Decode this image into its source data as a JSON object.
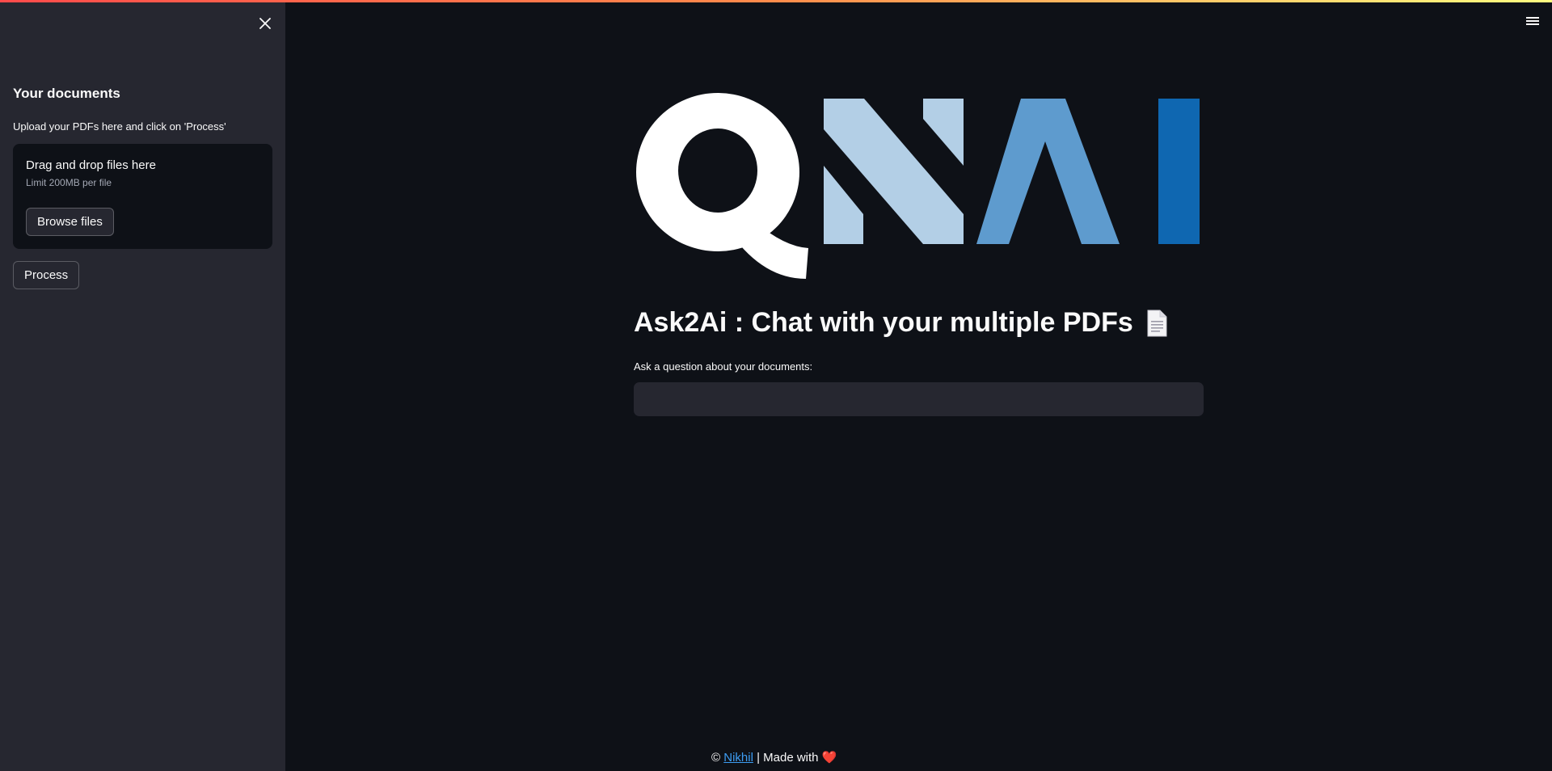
{
  "sidebar": {
    "close_icon": "close-icon",
    "heading": "Your documents",
    "upload_label": "Upload your PDFs here and click on 'Process'",
    "dropzone": {
      "title": "Drag and drop files here",
      "limit": "Limit 200MB per file",
      "browse_label": "Browse files"
    },
    "process_label": "Process"
  },
  "header": {
    "menu_icon": "hamburger-menu-icon"
  },
  "main": {
    "logo_text": "QNAI",
    "title": "Ask2Ai : Chat with your multiple PDFs",
    "title_icon": "document-icon",
    "question_label": "Ask a question about your documents:",
    "question_value": ""
  },
  "footer": {
    "copyright": "©",
    "author": "Nikhil",
    "made_with": "| Made with",
    "heart": "❤️"
  },
  "colors": {
    "background": "#0e1117",
    "sidebar": "#262730",
    "logo_light": "#b3cfe6",
    "logo_mid": "#5e9bce",
    "logo_dark": "#0f67b1",
    "link": "#3d9df3"
  }
}
